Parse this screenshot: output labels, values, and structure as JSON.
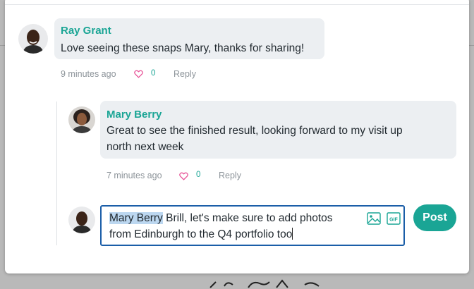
{
  "colors": {
    "accent": "#1aa595",
    "mention_highlight": "#bcd7f0",
    "input_border": "#1b5ea8",
    "heart": "#e8579a"
  },
  "comments": [
    {
      "author": "Ray Grant",
      "text": "Love seeing these snaps Mary, thanks for sharing!",
      "time": "9 minutes ago",
      "likes": "0",
      "reply_label": "Reply"
    },
    {
      "author": "Mary Berry",
      "text_line1": "Great to see the finished result, looking forward to my visit up",
      "text_line2": "north next week",
      "time": "7 minutes ago",
      "likes": "0",
      "reply_label": "Reply"
    }
  ],
  "composer": {
    "mention": "Mary Berry",
    "text_line1": " Brill, let's make sure to add photos",
    "text_line2": "from Edinburgh to the Q4 portfolio too",
    "image_icon": "image-icon",
    "gif_label": "GIF",
    "post_label": "Post"
  }
}
